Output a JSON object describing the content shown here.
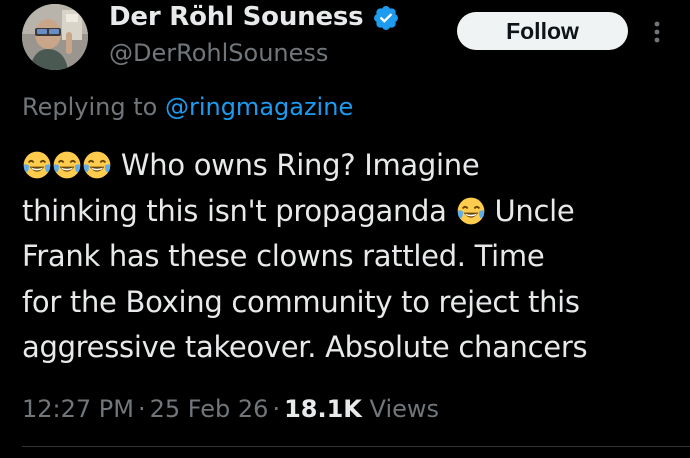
{
  "author": {
    "display_name": "Der Röhl Souness",
    "handle": "@DerRohlSouness",
    "verified": true,
    "verified_color": "#1d9bf0"
  },
  "actions": {
    "follow_label": "Follow",
    "more_icon": "more-vertical-icon"
  },
  "reply": {
    "prefix": "Replying to",
    "target": "@ringmagazine"
  },
  "tweet": {
    "line1_emojis": [
      "face-with-tears-of-joy",
      "face-with-tears-of-joy",
      "face-with-tears-of-joy"
    ],
    "line1_text": "Who owns Ring? Imagine",
    "line2_text_before": "thinking this isn't propaganda",
    "line2_emoji": "face-with-tears-of-joy",
    "line2_text_after": "Uncle",
    "line3_text": "Frank has these clowns rattled. Time",
    "line4_text": "for the Boxing community to reject this",
    "line5_text": "aggressive takeover. Absolute chancers"
  },
  "meta": {
    "time": "12:27 PM",
    "separator": "·",
    "date": "25 Feb 26",
    "views_count": "18.1K",
    "views_label": "Views"
  },
  "colors": {
    "background": "#000000",
    "text_primary": "#e7e9ea",
    "text_secondary": "#71767b",
    "link": "#1d9bf0",
    "divider": "#2f3336"
  }
}
